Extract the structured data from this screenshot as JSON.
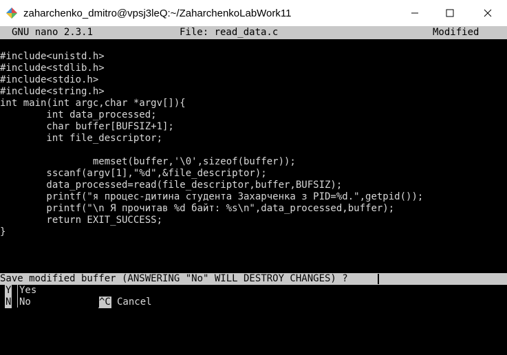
{
  "window": {
    "title": "zaharchenko_dmitro@vpsj3leQ:~/ZaharchenkoLabWork11",
    "icons": [
      "app-icon",
      "minimize-icon",
      "maximize-icon",
      "close-icon"
    ]
  },
  "nano": {
    "version": "GNU nano 2.3.1",
    "file": "File: read_data.c",
    "status": "Modified"
  },
  "code_lines": [
    "",
    "#include<unistd.h>",
    "#include<stdlib.h>",
    "#include<stdio.h>",
    "#include<string.h>",
    "int main(int argc,char *argv[]){",
    "        int data_processed;",
    "        char buffer[BUFSIZ+1];",
    "        int file_descriptor;",
    "",
    "                memset(buffer,'\\0',sizeof(buffer));",
    "        sscanf(argv[1],\"%d\",&file_descriptor);",
    "        data_processed=read(file_descriptor,buffer,BUFSIZ);",
    "        printf(\"я процес-дитина студента Захарченка з PID=%d.\",getpid());",
    "        printf(\"\\n Я прочитав %d байт: %s\\n\",data_processed,buffer);",
    "        return EXIT_SUCCESS;",
    "}"
  ],
  "prompt": {
    "text": "Save modified buffer (ANSWERING \"No\" WILL DESTROY CHANGES) ? "
  },
  "options": {
    "yes_key": "Y",
    "yes_label": "Yes",
    "no_key": "N",
    "no_label": "No",
    "cancel_key": "^C",
    "cancel_label": "Cancel"
  },
  "colors": {
    "title_bg": "#ffffff",
    "terminal_bg": "#000000",
    "terminal_fg": "#d9d9d9",
    "inverse_bg": "#c8c8c8"
  }
}
